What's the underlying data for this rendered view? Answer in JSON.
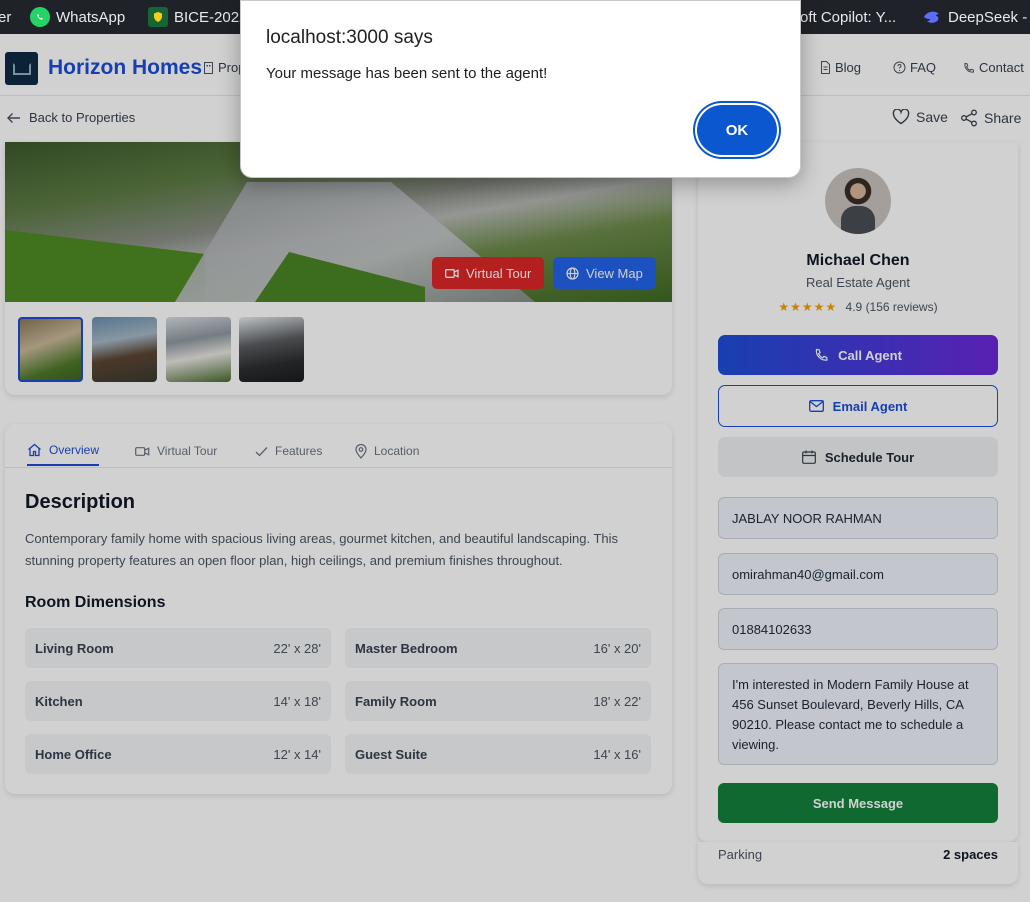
{
  "bookmarks": [
    {
      "label": "er",
      "icon": "bookmark-icon"
    },
    {
      "label": "WhatsApp",
      "icon": "whatsapp-icon"
    },
    {
      "label": "BICE-2022",
      "icon": "shield-icon"
    },
    {
      "label": "oft Copilot: Y...",
      "icon": "copilot-icon"
    },
    {
      "label": "DeepSeek -",
      "icon": "deepseek-icon"
    }
  ],
  "header": {
    "brand": "Horizon Homes",
    "nav": [
      {
        "label": "Prop",
        "icon": "building-icon"
      },
      {
        "label": "Blog",
        "icon": "document-icon"
      },
      {
        "label": "FAQ",
        "icon": "help-circle-icon"
      },
      {
        "label": "Contact",
        "icon": "phone-icon"
      }
    ]
  },
  "subbar": {
    "back_label": "Back to Properties",
    "save_label": "Save",
    "share_label": "Share"
  },
  "gallery": {
    "virtual_tour_label": "Virtual Tour",
    "view_map_label": "View Map",
    "thumb_count": 4
  },
  "tabs": [
    {
      "label": "Overview",
      "icon": "home-icon",
      "active": true
    },
    {
      "label": "Virtual Tour",
      "icon": "video-icon",
      "active": false
    },
    {
      "label": "Features",
      "icon": "check-icon",
      "active": false
    },
    {
      "label": "Location",
      "icon": "map-pin-icon",
      "active": false
    }
  ],
  "description": {
    "title": "Description",
    "text": "Contemporary family home with spacious living areas, gourmet kitchen, and beautiful landscaping. This stunning property features an open floor plan, high ceilings, and premium finishes throughout."
  },
  "rooms": {
    "title": "Room Dimensions",
    "items": [
      {
        "name": "Living Room",
        "dims": "22' x 28'"
      },
      {
        "name": "Master Bedroom",
        "dims": "16' x 20'"
      },
      {
        "name": "Kitchen",
        "dims": "14' x 18'"
      },
      {
        "name": "Family Room",
        "dims": "18' x 22'"
      },
      {
        "name": "Home Office",
        "dims": "12' x 14'"
      },
      {
        "name": "Guest Suite",
        "dims": "14' x 16'"
      }
    ]
  },
  "agent": {
    "name": "Michael Chen",
    "role": "Real Estate Agent",
    "rating": "4.9",
    "reviews": "(156 reviews)",
    "call_label": "Call Agent",
    "email_label": "Email Agent",
    "schedule_label": "Schedule Tour",
    "form": {
      "name_value": "JABLAY NOOR RAHMAN",
      "email_value": "omirahman40@gmail.com",
      "phone_value": "01884102633",
      "message_value": "I'm interested in Modern Family House at 456 Sunset Boulevard, Beverly Hills, CA 90210. Please contact me to schedule a viewing.",
      "send_label": "Send Message"
    }
  },
  "parking": {
    "label": "Parking",
    "value": "2 spaces"
  },
  "dialog": {
    "title": "localhost:3000 says",
    "message": "Your message has been sent to the agent!",
    "ok_label": "OK"
  },
  "colors": {
    "brand": "#1d4ed8",
    "virtual_tour_btn": "#dc2626",
    "view_map_btn": "#2563eb",
    "send_btn": "#15803d",
    "dialog_ok": "#0b57d0"
  }
}
